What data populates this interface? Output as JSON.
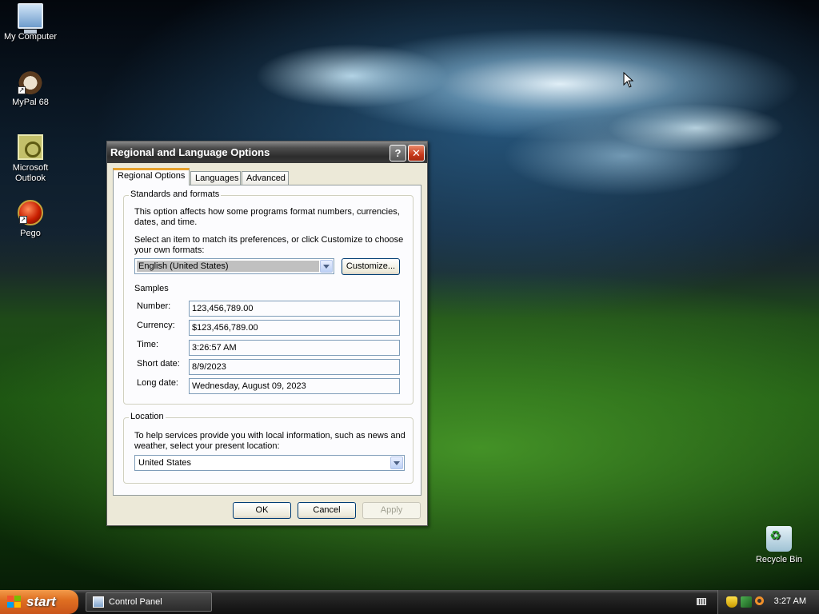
{
  "desktop": {
    "icons": [
      {
        "label": "My Computer",
        "icon": "computer-icon"
      },
      {
        "label": "MyPal 68",
        "icon": "mypal-icon"
      },
      {
        "label": "Microsoft Outlook",
        "icon": "outlook-icon"
      },
      {
        "label": "Pego",
        "icon": "pego-icon"
      },
      {
        "label": "Recycle Bin",
        "icon": "recycle-bin-icon"
      }
    ]
  },
  "dialog": {
    "title": "Regional and Language Options",
    "help_glyph": "?",
    "close_glyph": "✕",
    "tabs": [
      {
        "label": "Regional Options",
        "active": true
      },
      {
        "label": "Languages",
        "active": false
      },
      {
        "label": "Advanced",
        "active": false
      }
    ],
    "standards": {
      "group_title": "Standards and formats",
      "description": "This option affects how some programs format numbers, currencies, dates, and time.",
      "select_prompt": "Select an item to match its preferences, or click Customize to choose your own formats:",
      "selected_format": "English (United States)",
      "customize_label": "Customize...",
      "samples_title": "Samples",
      "samples": [
        {
          "label": "Number:",
          "value": "123,456,789.00"
        },
        {
          "label": "Currency:",
          "value": "$123,456,789.00"
        },
        {
          "label": "Time:",
          "value": "3:26:57 AM"
        },
        {
          "label": "Short date:",
          "value": "8/9/2023"
        },
        {
          "label": "Long date:",
          "value": "Wednesday, August 09, 2023"
        }
      ]
    },
    "location": {
      "group_title": "Location",
      "description": "To help services provide you with local information, such as news and weather, select your present location:",
      "selected_location": "United States"
    },
    "buttons": {
      "ok": "OK",
      "cancel": "Cancel",
      "apply": "Apply"
    }
  },
  "taskbar": {
    "start_label": "start",
    "tasks": [
      {
        "label": "Control Panel"
      }
    ],
    "clock": "3:27 AM"
  }
}
